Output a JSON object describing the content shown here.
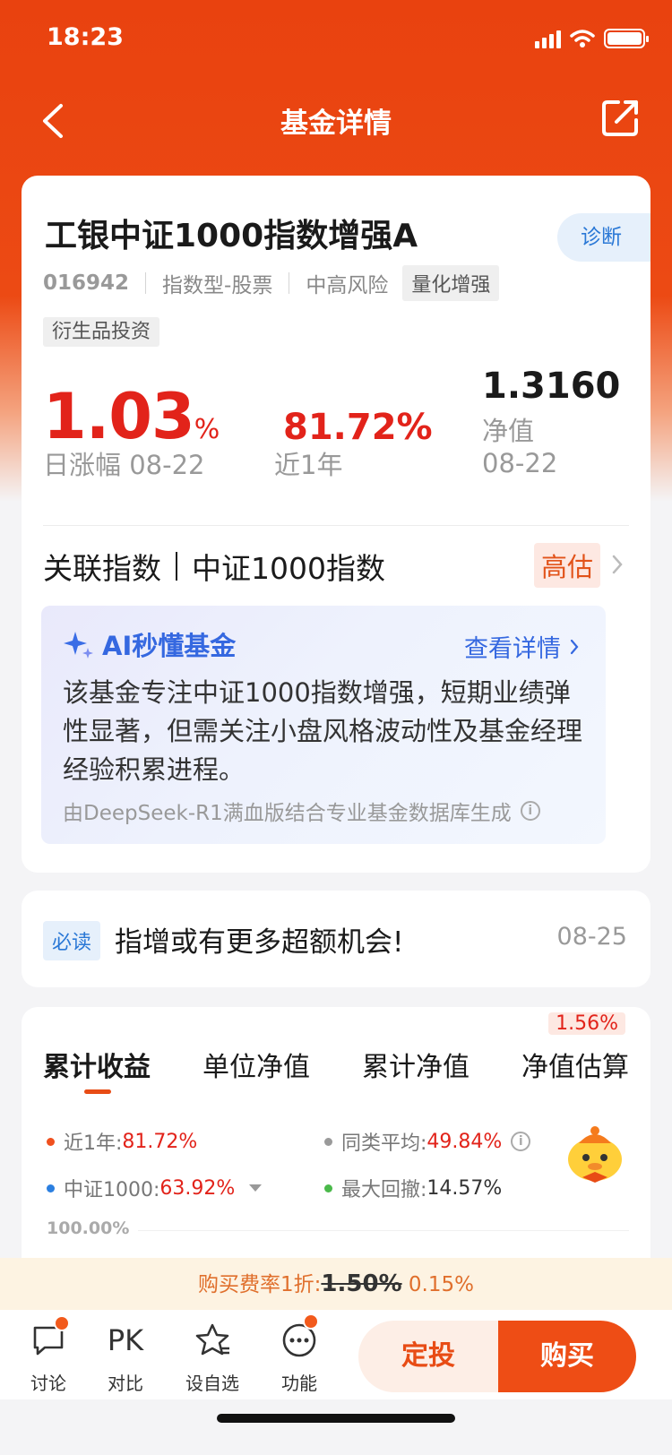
{
  "status_bar": {
    "time": "18:23"
  },
  "nav": {
    "title": "基金详情"
  },
  "fund": {
    "name": "工银中证1000指数增强A",
    "diagnose_label": "诊断",
    "code": "016942",
    "type": "指数型-股票",
    "risk": "中高风险",
    "tags": [
      "量化增强",
      "衍生品投资"
    ]
  },
  "stats": {
    "daily_change": "1.03",
    "daily_change_unit": "%",
    "daily_label": "日涨幅 08-22",
    "one_year": "81.72%",
    "one_year_label": "近1年",
    "nav_value": "1.3160",
    "nav_label": "净值",
    "nav_date": "08-22"
  },
  "index": {
    "label": "关联指数",
    "name": "中证1000指数",
    "valuation": "高估"
  },
  "ai": {
    "title": "AI秒懂基金",
    "more": "查看详情",
    "summary": "该基金专注中证1000指数增强，短期业绩弹性显著，但需关注小盘风格波动性及基金经理经验积累进程。",
    "source": "由DeepSeek-R1满血版结合专业基金数据库生成"
  },
  "news": {
    "badge": "必读",
    "text": "指增或有更多超额机会!",
    "date": "08-25"
  },
  "chart": {
    "tabs": [
      "累计收益",
      "单位净值",
      "累计净值",
      "净值估算"
    ],
    "estimate_badge": "1.56%",
    "legend": [
      {
        "label": "近1年:",
        "value": "81.72%",
        "color": "#f0501e"
      },
      {
        "label": "同类平均:",
        "value": "49.84%",
        "color": "#9a9a9a"
      },
      {
        "label": "中证1000:",
        "value": "63.92%",
        "color": "#2b7fe0"
      },
      {
        "label": "最大回撤:",
        "value": "14.57%",
        "color": "#4ab94a"
      }
    ],
    "y_tick_top": "100.00%"
  },
  "fee": {
    "prefix": "购买费率1折:",
    "original": "1.50%",
    "discounted": "0.15%"
  },
  "bottom_bar": {
    "items": [
      "讨论",
      "对比",
      "设自选",
      "功能"
    ],
    "pk_label": "PK",
    "sip_button": "定投",
    "buy_button": "购买"
  }
}
